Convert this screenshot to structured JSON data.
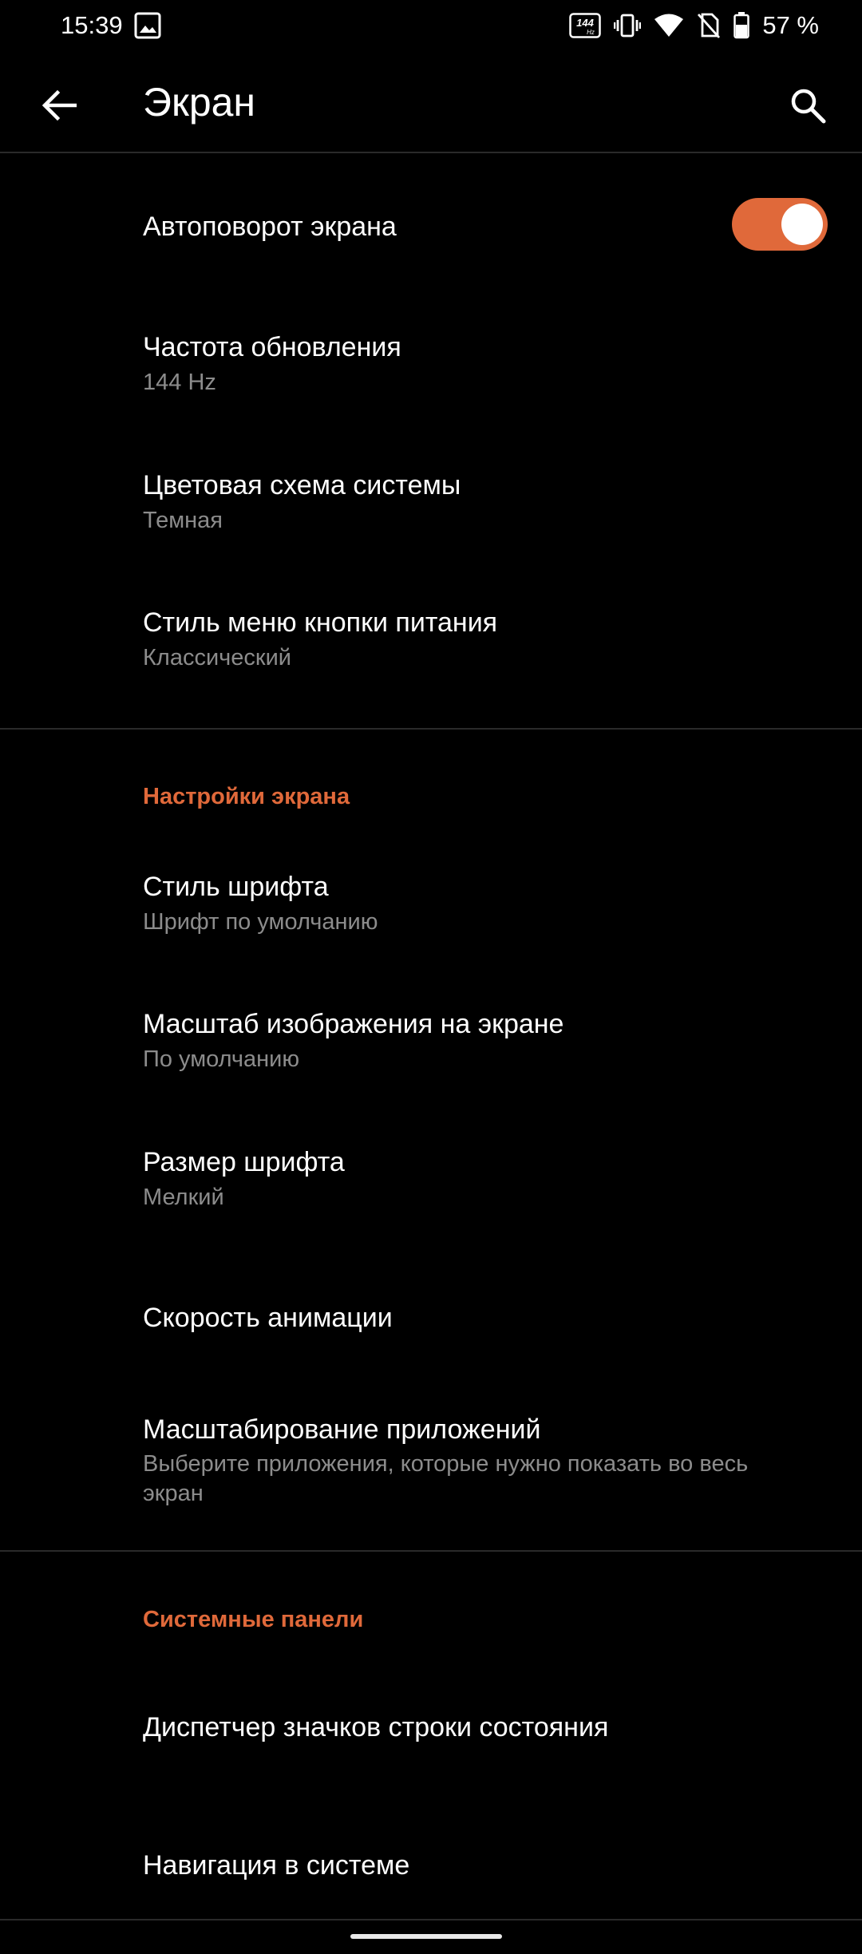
{
  "status_bar": {
    "time": "15:39",
    "refresh_badge": "144",
    "refresh_badge_unit": "Hz",
    "battery": "57 %",
    "icons": [
      "gallery-icon",
      "refresh-rate-icon",
      "vibrate-icon",
      "wifi-icon",
      "no-sim-icon",
      "battery-icon"
    ]
  },
  "app_bar": {
    "title": "Экран",
    "back_icon": "arrow-back-icon",
    "search_icon": "search-icon"
  },
  "accent_color": "#e0693a",
  "items_top": [
    {
      "title": "Автоповорот экрана",
      "toggle_on": true
    },
    {
      "title": "Частота обновления",
      "summary": "144 Hz"
    },
    {
      "title": "Цветовая схема системы",
      "summary": "Темная"
    },
    {
      "title": "Стиль меню кнопки питания",
      "summary": "Классический"
    }
  ],
  "section_display": {
    "header": "Настройки экрана",
    "items": [
      {
        "title": "Стиль шрифта",
        "summary": "Шрифт по умолчанию"
      },
      {
        "title": "Масштаб изображения на экране",
        "summary": "По умолчанию"
      },
      {
        "title": "Размер шрифта",
        "summary": "Мелкий"
      },
      {
        "title": "Скорость анимации"
      },
      {
        "title": "Масштабирование приложений",
        "summary": "Выберите приложения, которые нужно показать во весь экран"
      }
    ]
  },
  "section_panels": {
    "header": "Системные панели",
    "items": [
      {
        "title": "Диспетчер значков строки состояния"
      },
      {
        "title": "Навигация в системе"
      }
    ]
  }
}
